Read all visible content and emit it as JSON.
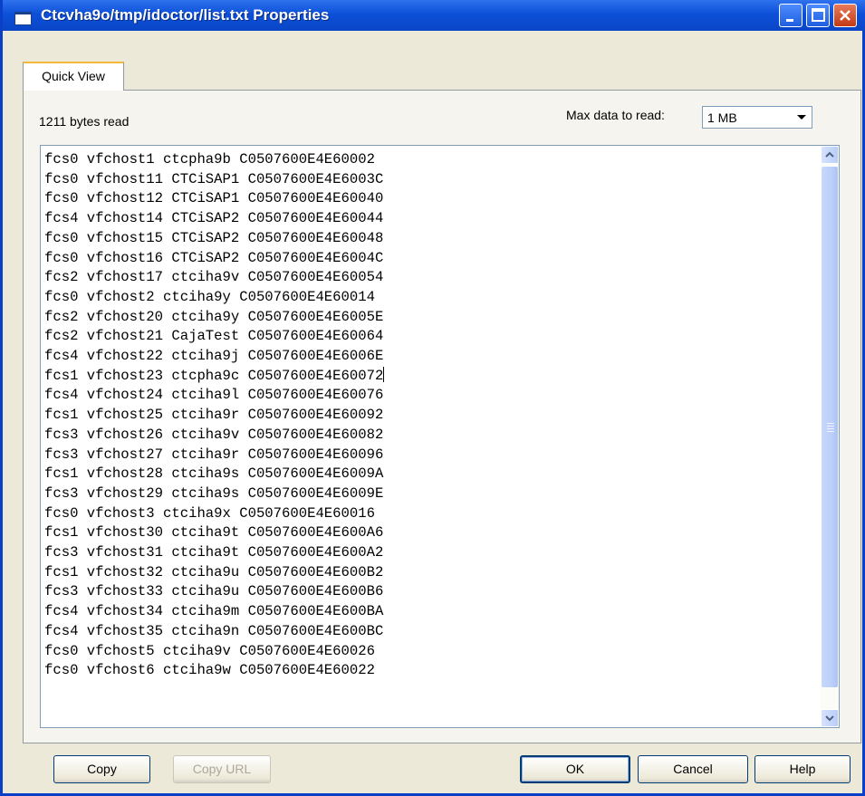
{
  "window": {
    "title": "Ctcvha9o/tmp/idoctor/list.txt Properties"
  },
  "tabs": [
    {
      "label": "Quick View"
    }
  ],
  "quick_view": {
    "bytes_read": "1211 bytes read",
    "max_label": "Max data to read:",
    "max_value": "1 MB",
    "lines": [
      "fcs0 vfchost1 ctcpha9b C0507600E4E60002",
      "fcs0 vfchost11 CTCiSAP1 C0507600E4E6003C",
      "fcs0 vfchost12 CTCiSAP1 C0507600E4E60040",
      "fcs4 vfchost14 CTCiSAP2 C0507600E4E60044",
      "fcs0 vfchost15 CTCiSAP2 C0507600E4E60048",
      "fcs0 vfchost16 CTCiSAP2 C0507600E4E6004C",
      "fcs2 vfchost17 ctciha9v C0507600E4E60054",
      "fcs0 vfchost2 ctciha9y C0507600E4E60014",
      "fcs2 vfchost20 ctciha9y C0507600E4E6005E",
      "fcs2 vfchost21 CajaTest C0507600E4E60064",
      "fcs4 vfchost22 ctciha9j C0507600E4E6006E",
      "fcs1 vfchost23 ctcpha9c C0507600E4E60072",
      "fcs4 vfchost24 ctciha9l C0507600E4E60076",
      "fcs1 vfchost25 ctciha9r C0507600E4E60092",
      "fcs3 vfchost26 ctciha9v C0507600E4E60082",
      "fcs3 vfchost27 ctciha9r C0507600E4E60096",
      "fcs1 vfchost28 ctciha9s C0507600E4E6009A",
      "fcs3 vfchost29 ctciha9s C0507600E4E6009E",
      "fcs0 vfchost3 ctciha9x C0507600E4E60016",
      "fcs1 vfchost30 ctciha9t C0507600E4E600A6",
      "fcs3 vfchost31 ctciha9t C0507600E4E600A2",
      "fcs1 vfchost32 ctciha9u C0507600E4E600B2",
      "fcs3 vfchost33 ctciha9u C0507600E4E600B6",
      "fcs4 vfchost34 ctciha9m C0507600E4E600BA",
      "fcs4 vfchost35 ctciha9n C0507600E4E600BC",
      "fcs0 vfchost5 ctciha9v C0507600E4E60026",
      "fcs0 vfchost6 ctciha9w C0507600E4E60022"
    ]
  },
  "buttons": {
    "copy": "Copy",
    "copy_url": "Copy URL",
    "ok": "OK",
    "cancel": "Cancel",
    "help": "Help"
  }
}
